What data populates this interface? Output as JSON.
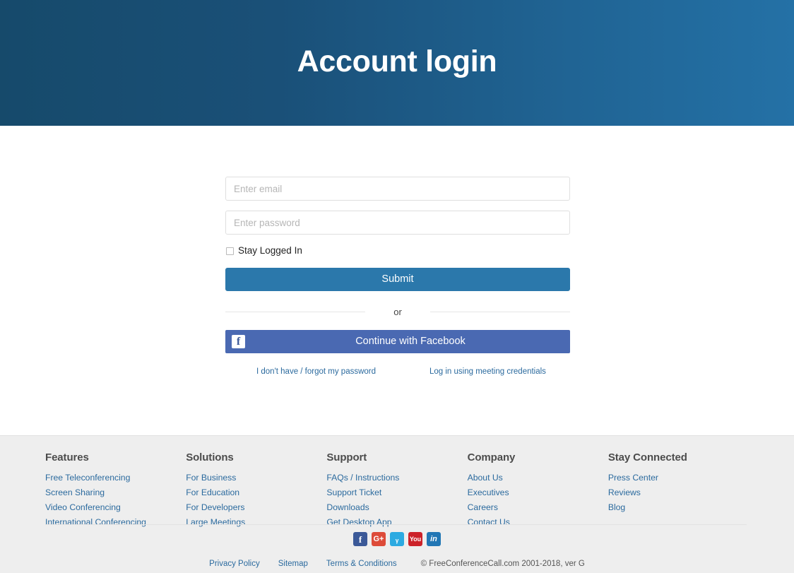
{
  "hero": {
    "title": "Account login",
    "gradient_from": "#164a6b",
    "gradient_to": "#2471a6"
  },
  "form": {
    "email": {
      "value": "",
      "placeholder": "Enter email"
    },
    "password": {
      "value": "",
      "placeholder": "Enter password"
    },
    "stay_logged_in_label": "Stay Logged In",
    "stay_logged_in_checked": false,
    "submit_label": "Submit",
    "divider_label": "or",
    "facebook_label": "Continue with Facebook",
    "facebook_icon_glyph": "f",
    "facebook_color": "#4a69b2",
    "submit_color": "#2b78ab",
    "forgot_password_link": "I don't have / forgot my password",
    "meeting_credentials_link": "Log in using meeting credentials"
  },
  "footer": {
    "columns": [
      {
        "title": "Features",
        "links": [
          "Free Teleconferencing",
          "Screen Sharing",
          "Video Conferencing",
          "International Conferencing"
        ]
      },
      {
        "title": "Solutions",
        "links": [
          "For Business",
          "For Education",
          "For Developers",
          "Large Meetings"
        ]
      },
      {
        "title": "Support",
        "links": [
          "FAQs / Instructions",
          "Support Ticket",
          "Downloads",
          "Get Desktop App"
        ]
      },
      {
        "title": "Company",
        "links": [
          "About Us",
          "Executives",
          "Careers",
          "Contact Us"
        ]
      },
      {
        "title": "Stay Connected",
        "links": [
          "Press Center",
          "Reviews",
          "Blog"
        ]
      }
    ],
    "social": [
      {
        "name": "facebook",
        "glyph": "f",
        "color": "#3b5998"
      },
      {
        "name": "google-plus",
        "glyph": "G+",
        "color": "#dd4b39"
      },
      {
        "name": "twitter",
        "glyph": "ᵧ",
        "color": "#2caae1"
      },
      {
        "name": "youtube",
        "glyph": "You",
        "color": "#cc2229"
      },
      {
        "name": "linkedin",
        "glyph": "in",
        "color": "#2277b5"
      }
    ],
    "bottom": {
      "privacy": "Privacy Policy",
      "sitemap": "Sitemap",
      "terms": "Terms & Conditions",
      "copyright": "© FreeConferenceCall.com 2001-2018, ver G"
    }
  },
  "colors": {
    "link": "#2b6a9e",
    "footer_bg": "#eeeeee",
    "heading": "#4c4c4c"
  }
}
